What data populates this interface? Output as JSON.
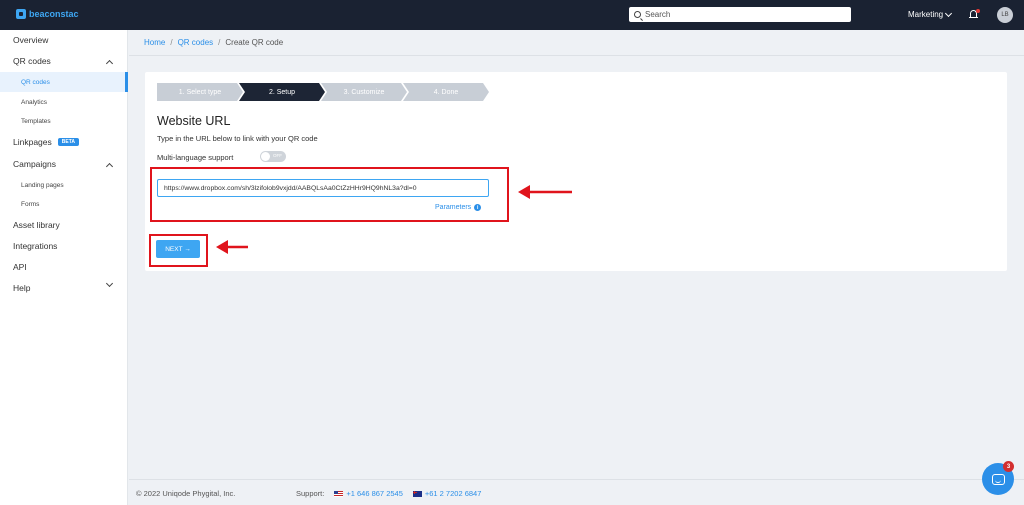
{
  "header": {
    "logo_text": "beaconstac",
    "search_placeholder": "Search",
    "workspace": "Marketing",
    "avatar_initials": "LB"
  },
  "sidebar": {
    "items": [
      {
        "label": "Overview"
      },
      {
        "label": "QR codes"
      },
      {
        "label": "QR codes"
      },
      {
        "label": "Analytics"
      },
      {
        "label": "Templates"
      },
      {
        "label": "Linkpages",
        "badge": "BETA"
      },
      {
        "label": "Campaigns"
      },
      {
        "label": "Landing pages"
      },
      {
        "label": "Forms"
      },
      {
        "label": "Asset library"
      },
      {
        "label": "Integrations"
      },
      {
        "label": "API"
      },
      {
        "label": "Help"
      }
    ]
  },
  "breadcrumb": {
    "home": "Home",
    "qr_codes": "QR codes",
    "current": "Create QR code",
    "sep": "/"
  },
  "steps": [
    {
      "label": "1. Select type"
    },
    {
      "label": "2. Setup"
    },
    {
      "label": "3. Customize"
    },
    {
      "label": "4. Done"
    }
  ],
  "form": {
    "title": "Website URL",
    "subtitle": "Type in the URL below to link with your QR code",
    "multilang_label": "Multi-language support",
    "toggle_state": "OFF",
    "url_value": "https://www.dropbox.com/sh/3lzifolob9vxjdd/AABQLsAa0CtZzHHr9HQ9hNL3a?dl=0",
    "parameters_label": "Parameters",
    "info_glyph": "i",
    "next_label": "NEXT →"
  },
  "footer": {
    "copyright": "© 2022 Uniqode Phygital, Inc.",
    "support_label": "Support:",
    "phone_us": "+1 646 867 2545",
    "phone_au": "+61 2 7202 6847"
  },
  "chat": {
    "badge_count": "3"
  },
  "colors": {
    "accent": "#2b8fe8",
    "topbar": "#1a2232",
    "annotation_red": "#e0141c"
  }
}
